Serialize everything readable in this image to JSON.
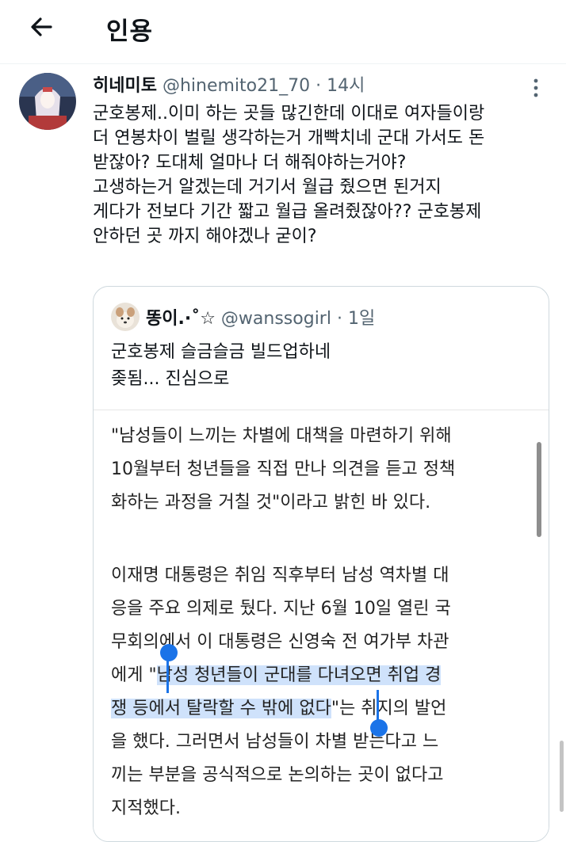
{
  "header": {
    "title": "인용"
  },
  "tweet": {
    "name": "히네미토",
    "handle": "@hinemito21_70",
    "dot": "·",
    "time": "14시",
    "lines": [
      "군호봉제..이미 하는 곳들 많긴한데 이대로 여자들이랑",
      "더 연봉차이 벌릴 생각하는거 개빡치네 군대 가서도 돈",
      "받잖아? 도대체 얼마나 더 해줘야하는거야?",
      "고생하는거 알겠는데 거기서 월급 줬으면 된거지",
      "게다가 전보다 기간 짧고 월급 올려줬잖아?? 군호봉제",
      "안하던 곳 까지 해야겠나 굳이?"
    ]
  },
  "quoted": {
    "name": "똥이.·˚☆",
    "handle": "@wanssogirl",
    "dot": "·",
    "time": "1일",
    "lines": [
      "군호봉제 슬금슬금 빌드업하네",
      "좆됨... 진심으로"
    ]
  },
  "article": {
    "para1": [
      "\"남성들이 느끼는 차별에 대책을 마련하기 위해",
      "10월부터 청년들을 직접 만나 의견을 듣고 정책",
      "화하는 과정을 거칠 것\"이라고 밝힌 바 있다."
    ],
    "para2": {
      "l1": "이재명 대통령은 취임 직후부터 남성 역차별 대",
      "l2": "응을 주요 의제로 뒀다. 지난 6월 10일 열린 국",
      "l3": "무회의에서 이 대통령은 신영숙 전 여가부 차관",
      "l4_pre": "에게 \"",
      "l4_hl": "남성 청년들이 군대를 다녀오면 취업 경",
      "l5_hl": "쟁 등에서 탈락할 수 밖에 없다",
      "l5_post": "\"는 취지의 발언",
      "l6": "을 했다. 그러면서 남성들이 차별 받는다고 느",
      "l7": "끼는 부분을 공식적으로 논의하는 곳이 없다고",
      "l8": "지적했다."
    }
  },
  "colors": {
    "text": "#0f1419",
    "secondary": "#536471",
    "selection": "#cfe2fb",
    "handle": "#1a73e8"
  }
}
